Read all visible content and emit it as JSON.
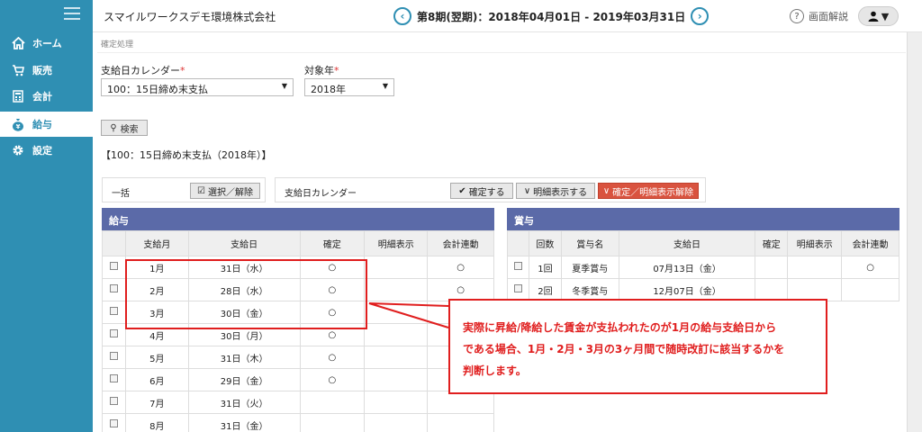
{
  "header": {
    "company": "スマイルワークスデモ環境株式会社",
    "period": "第8期(翌期)：2018年04月01日 - 2019年03月31日",
    "help_label": "画面解説"
  },
  "sidebar": {
    "items": [
      {
        "label": "ホーム",
        "icon": "home-icon"
      },
      {
        "label": "販売",
        "icon": "cart-icon"
      },
      {
        "label": "会計",
        "icon": "calculator-icon"
      },
      {
        "label": "給与",
        "icon": "money-bag-icon",
        "active": true
      },
      {
        "label": "設定",
        "icon": "gear-icon"
      }
    ]
  },
  "breadcrumb": "確定処理",
  "form": {
    "calendar_label": "支給日カレンダー",
    "calendar_value": "100：15日締め末支払",
    "year_label": "対象年",
    "year_value": "2018年",
    "required_mark": "*",
    "search_label": "検索",
    "caption": "【100：15日締め末支払（2018年）】"
  },
  "bulk": {
    "label": "一括",
    "select_clear": "選択／解除"
  },
  "calendar_bar": {
    "label": "支給日カレンダー",
    "confirm": "確定する",
    "detail": "明細表示する",
    "release": "確定／明細表示解除"
  },
  "salary": {
    "title": "給与",
    "columns": [
      "支給月",
      "支給日",
      "確定",
      "明細表示",
      "会計連動"
    ],
    "rows": [
      {
        "month": "1月",
        "date": "31日（水）",
        "confirmed": "○",
        "detail": "",
        "accounting": "○"
      },
      {
        "month": "2月",
        "date": "28日（水）",
        "confirmed": "○",
        "detail": "",
        "accounting": "○"
      },
      {
        "month": "3月",
        "date": "30日（金）",
        "confirmed": "○",
        "detail": "",
        "accounting": ""
      },
      {
        "month": "4月",
        "date": "30日（月）",
        "confirmed": "○",
        "detail": "",
        "accounting": ""
      },
      {
        "month": "5月",
        "date": "31日（木）",
        "confirmed": "○",
        "detail": "",
        "accounting": ""
      },
      {
        "month": "6月",
        "date": "29日（金）",
        "confirmed": "○",
        "detail": "",
        "accounting": ""
      },
      {
        "month": "7月",
        "date": "31日（火）",
        "confirmed": "",
        "detail": "",
        "accounting": ""
      },
      {
        "month": "8月",
        "date": "31日（金）",
        "confirmed": "",
        "detail": "",
        "accounting": ""
      }
    ]
  },
  "bonus": {
    "title": "賞与",
    "columns": [
      "回数",
      "賞与名",
      "支給日",
      "確定",
      "明細表示",
      "会計連動"
    ],
    "rows": [
      {
        "count": "1回",
        "name": "夏季賞与",
        "date": "07月13日（金）",
        "confirmed": "",
        "detail": "",
        "accounting": "○"
      },
      {
        "count": "2回",
        "name": "冬季賞与",
        "date": "12月07日（金）",
        "confirmed": "",
        "detail": "",
        "accounting": ""
      }
    ]
  },
  "callout": {
    "line1": "実際に昇給/降給した賃金が支払われたのが1月の給与支給日から",
    "line2": "である場合、1月・2月・3月の3ヶ月間で随時改訂に該当するかを",
    "line3": "判断します。"
  },
  "colors": {
    "sidebar": "#2f8fb3",
    "panel_header": "#5b6aa8",
    "highlight": "#e01e1e",
    "danger_button": "#d9533f"
  }
}
